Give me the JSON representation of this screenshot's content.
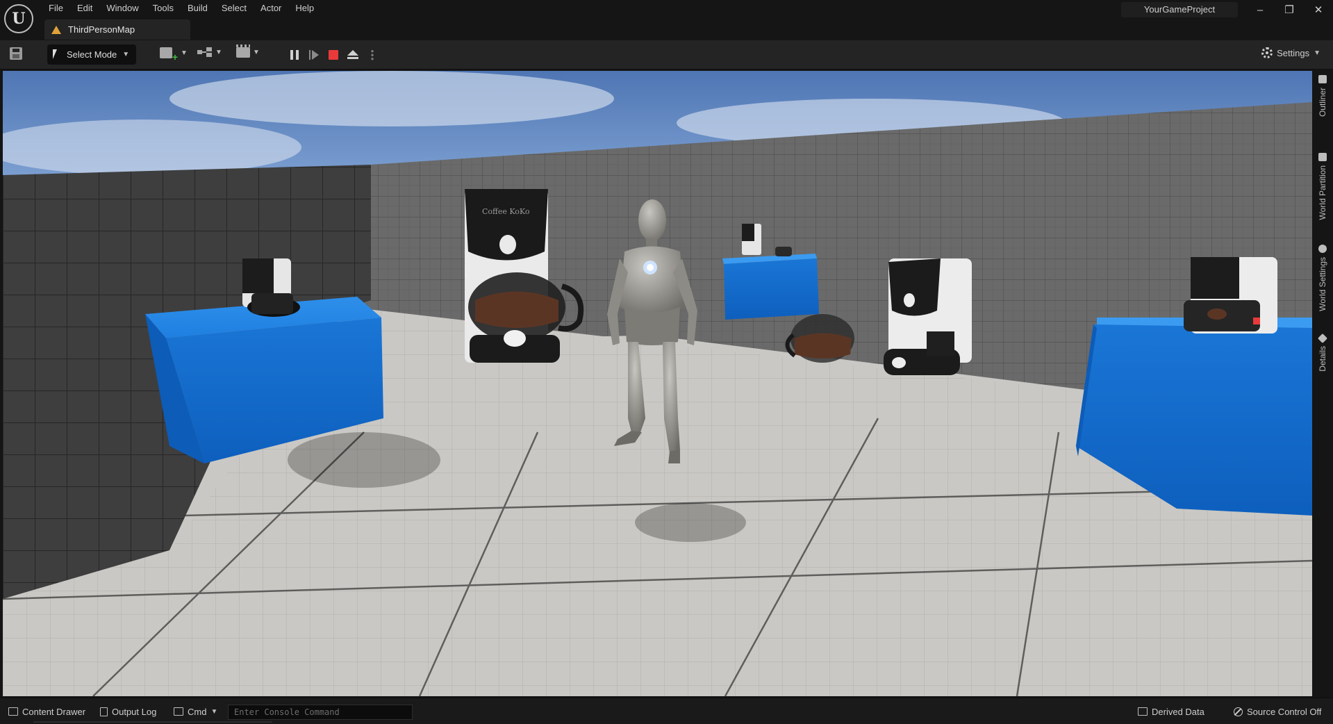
{
  "window": {
    "project_name": "YourGameProject",
    "controls": [
      "minimize",
      "restore",
      "close"
    ]
  },
  "menu": {
    "items": [
      "File",
      "Edit",
      "Window",
      "Tools",
      "Build",
      "Select",
      "Actor",
      "Help"
    ]
  },
  "map_tab": {
    "label": "ThirdPersonMap",
    "icon": "level-map-icon"
  },
  "toolbar": {
    "select_mode_label": "Select Mode",
    "settings_label": "Settings"
  },
  "side_tabs": [
    "Outliner",
    "World Partition",
    "World Settings",
    "Details"
  ],
  "scene": {
    "coffee_brand": "Coffee KoKo"
  },
  "statusbar": {
    "content_drawer": "Content Drawer",
    "output_log": "Output Log",
    "cmd_label": "Cmd",
    "console_placeholder": "Enter Console Command",
    "derived_data": "Derived Data",
    "source_control": "Source Control Off"
  },
  "colors": {
    "accent_blue": "#1f7fe0",
    "stop_red": "#e83a3a",
    "warning_orange": "#e0a23a",
    "editor_bg": "#151515"
  }
}
